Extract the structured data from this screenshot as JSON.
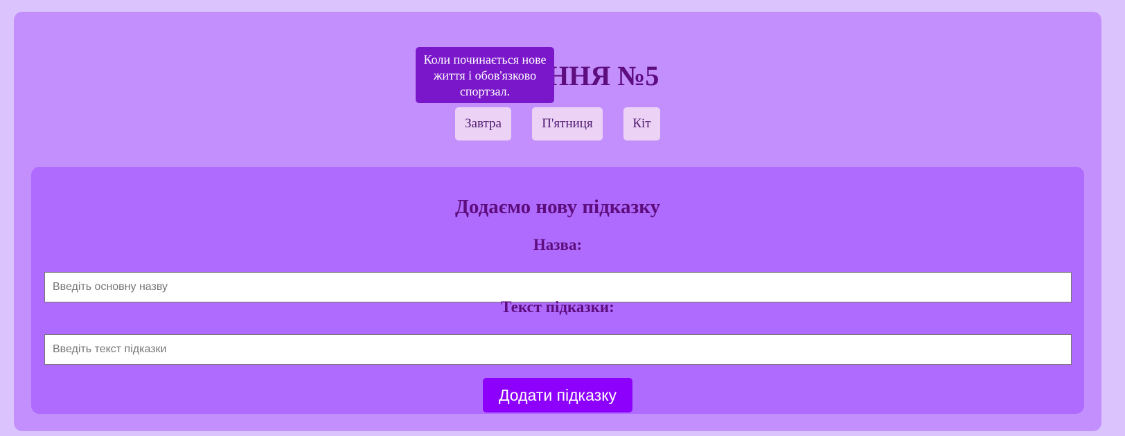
{
  "header": {
    "title": "ЗАВДАННЯ №5",
    "tooltip": "Коли починається нове життя і обов'язково спортзал."
  },
  "hint_buttons": [
    {
      "label": "Завтра"
    },
    {
      "label": "П'ятниця"
    },
    {
      "label": "Кіт"
    }
  ],
  "form": {
    "title": "Додаємо нову підказку",
    "name_label": "Назва:",
    "name_placeholder": "Введіть основну назву",
    "name_value": "",
    "text_label": "Текст підказки:",
    "text_placeholder": "Введіть текст підказки",
    "text_value": "",
    "submit_label": "Додати підказку"
  },
  "colors": {
    "page_background": "#dbc4fd",
    "container_background": "#c38ffd",
    "form_background": "#af6bfd",
    "heading_color": "#5e0d7e",
    "tooltip_background": "#7a17ca",
    "hint_button_background": "#ecd3f5",
    "submit_background": "#8c00fc"
  }
}
